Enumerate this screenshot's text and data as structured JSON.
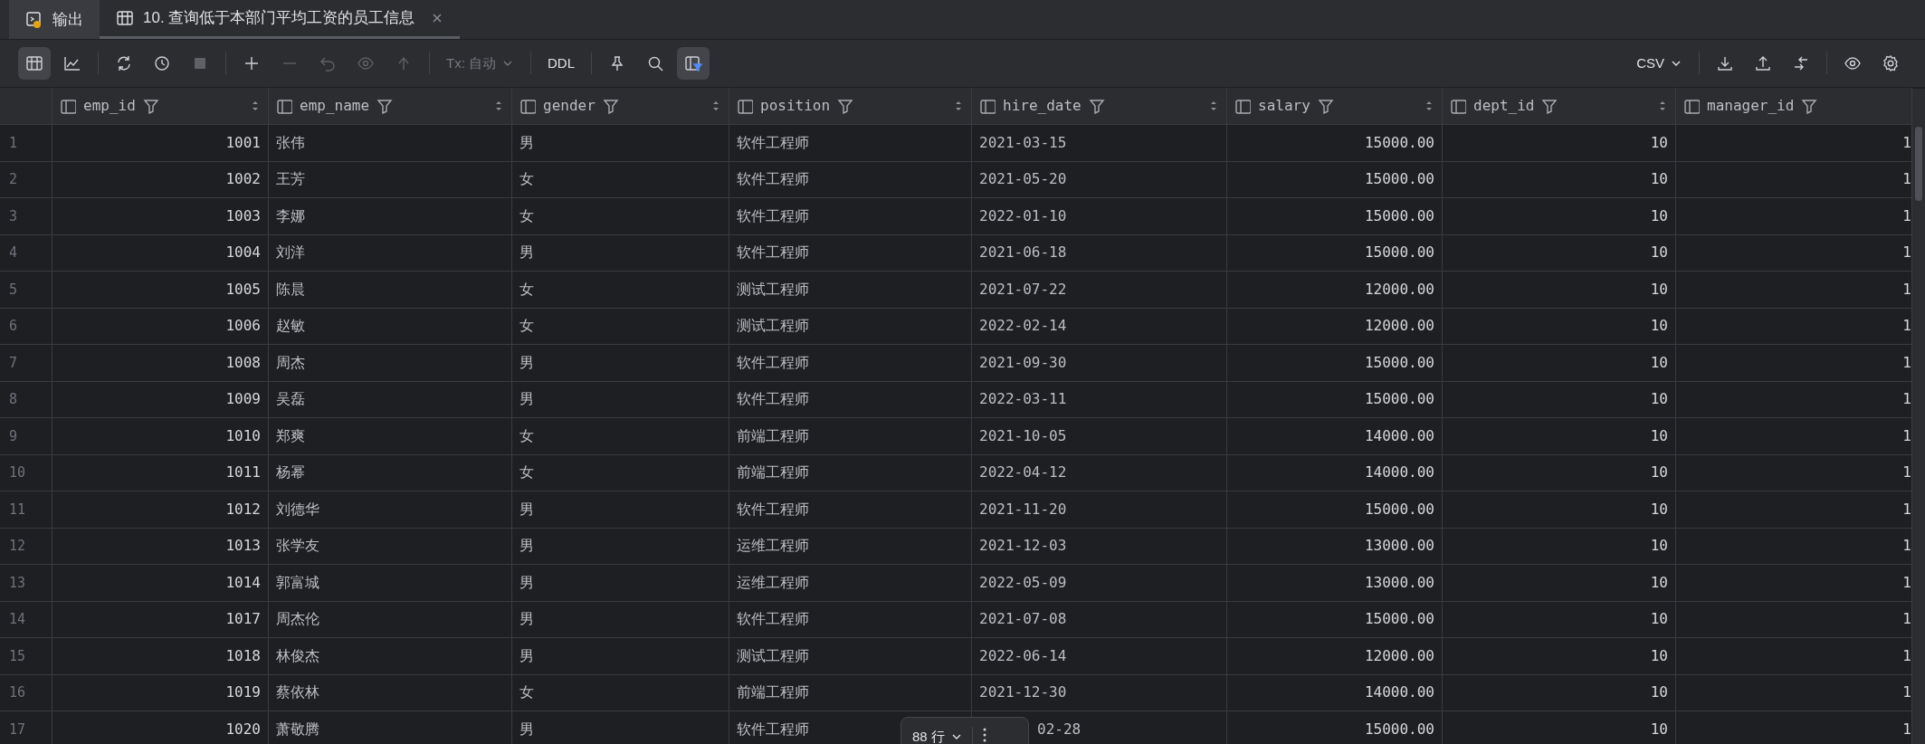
{
  "tabs": [
    {
      "label": "输出",
      "kind": "output",
      "selected": false
    },
    {
      "label": "10. 查询低于本部门平均工资的员工信息",
      "kind": "table",
      "selected": true
    }
  ],
  "toolbar": {
    "tx_mode": "Tx: 自动",
    "ddl": "DDL",
    "format": "CSV",
    "filter_active": true
  },
  "table": {
    "columns": [
      {
        "label": "emp_id",
        "kind": "number",
        "sortable": true
      },
      {
        "label": "emp_name",
        "kind": "text",
        "sortable": true
      },
      {
        "label": "gender",
        "kind": "text",
        "sortable": true
      },
      {
        "label": "position",
        "kind": "text",
        "sortable": true
      },
      {
        "label": "hire_date",
        "kind": "date",
        "sortable": true
      },
      {
        "label": "salary",
        "kind": "number",
        "sortable": true
      },
      {
        "label": "dept_id",
        "kind": "number",
        "sortable": true
      },
      {
        "label": "manager_id",
        "kind": "number",
        "sortable": false
      }
    ],
    "rows": [
      {
        "num": "1",
        "cells": [
          "1001",
          "张伟",
          "男",
          "软件工程师",
          "2021-03-15",
          "15000.00",
          "10",
          "1"
        ]
      },
      {
        "num": "2",
        "cells": [
          "1002",
          "王芳",
          "女",
          "软件工程师",
          "2021-05-20",
          "15000.00",
          "10",
          "1"
        ]
      },
      {
        "num": "3",
        "cells": [
          "1003",
          "李娜",
          "女",
          "软件工程师",
          "2022-01-10",
          "15000.00",
          "10",
          "1"
        ]
      },
      {
        "num": "4",
        "cells": [
          "1004",
          "刘洋",
          "男",
          "软件工程师",
          "2021-06-18",
          "15000.00",
          "10",
          "1"
        ]
      },
      {
        "num": "5",
        "cells": [
          "1005",
          "陈晨",
          "女",
          "测试工程师",
          "2021-07-22",
          "12000.00",
          "10",
          "1"
        ]
      },
      {
        "num": "6",
        "cells": [
          "1006",
          "赵敏",
          "女",
          "测试工程师",
          "2022-02-14",
          "12000.00",
          "10",
          "1"
        ]
      },
      {
        "num": "7",
        "cells": [
          "1008",
          "周杰",
          "男",
          "软件工程师",
          "2021-09-30",
          "15000.00",
          "10",
          "1"
        ]
      },
      {
        "num": "8",
        "cells": [
          "1009",
          "吴磊",
          "男",
          "软件工程师",
          "2022-03-11",
          "15000.00",
          "10",
          "1"
        ]
      },
      {
        "num": "9",
        "cells": [
          "1010",
          "郑爽",
          "女",
          "前端工程师",
          "2021-10-05",
          "14000.00",
          "10",
          "1"
        ]
      },
      {
        "num": "10",
        "cells": [
          "1011",
          "杨幂",
          "女",
          "前端工程师",
          "2022-04-12",
          "14000.00",
          "10",
          "1"
        ]
      },
      {
        "num": "11",
        "cells": [
          "1012",
          "刘德华",
          "男",
          "软件工程师",
          "2021-11-20",
          "15000.00",
          "10",
          "1"
        ]
      },
      {
        "num": "12",
        "cells": [
          "1013",
          "张学友",
          "男",
          "运维工程师",
          "2021-12-03",
          "13000.00",
          "10",
          "1"
        ]
      },
      {
        "num": "13",
        "cells": [
          "1014",
          "郭富城",
          "男",
          "运维工程师",
          "2022-05-09",
          "13000.00",
          "10",
          "1"
        ]
      },
      {
        "num": "14",
        "cells": [
          "1017",
          "周杰伦",
          "男",
          "软件工程师",
          "2021-07-08",
          "15000.00",
          "10",
          "1"
        ]
      },
      {
        "num": "15",
        "cells": [
          "1018",
          "林俊杰",
          "男",
          "测试工程师",
          "2022-06-14",
          "12000.00",
          "10",
          "1"
        ]
      },
      {
        "num": "16",
        "cells": [
          "1019",
          "蔡依林",
          "女",
          "前端工程师",
          "2021-12-30",
          "14000.00",
          "10",
          "1"
        ]
      },
      {
        "num": "17",
        "cells": [
          "1020",
          "萧敬腾",
          "男",
          "软件工程师",
          "02-28",
          "15000.00",
          "10",
          "1"
        ]
      }
    ]
  },
  "row_count": "88 行"
}
